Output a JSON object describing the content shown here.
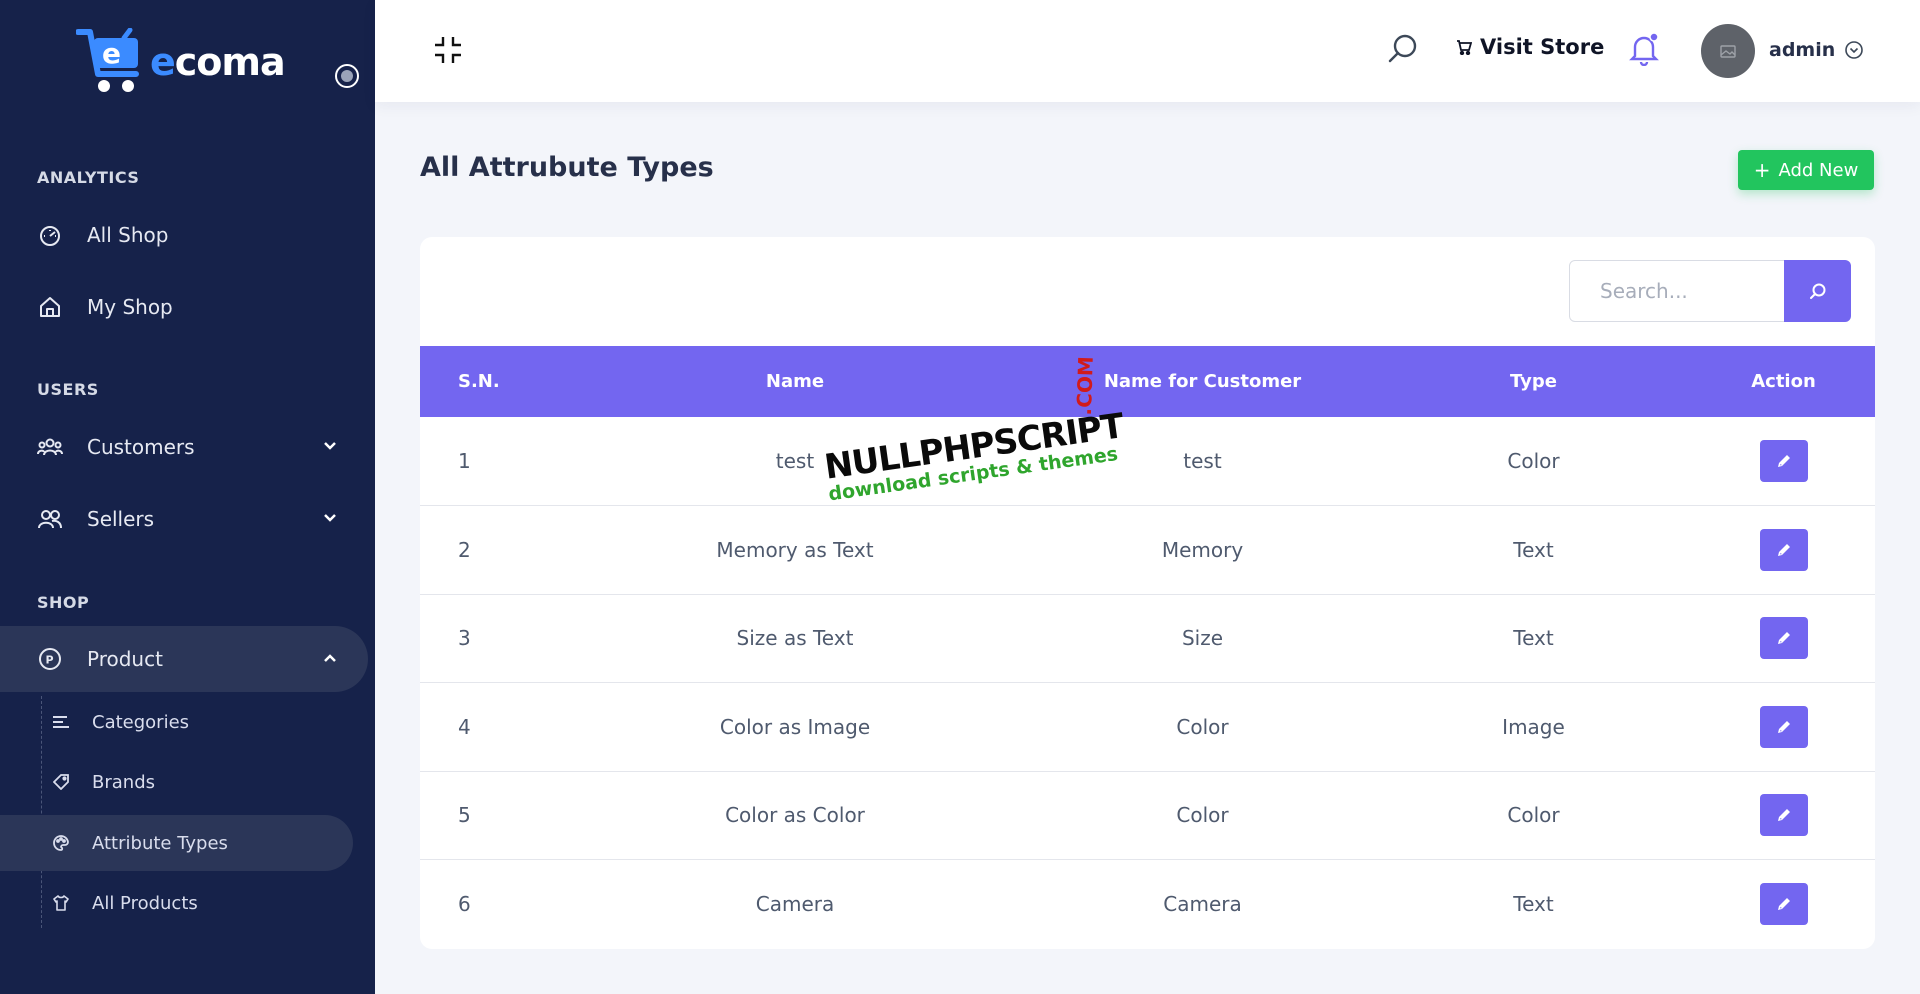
{
  "brand": {
    "name_prefix": "e",
    "name_rest": "coma"
  },
  "sidebar": {
    "sections": {
      "analytics": "ANALYTICS",
      "users": "USERS",
      "shop": "SHOP"
    },
    "items": {
      "all_shop": "All Shop",
      "my_shop": "My Shop",
      "customers": "Customers",
      "sellers": "Sellers",
      "product": "Product"
    },
    "sub_items": {
      "categories": "Categories",
      "brands": "Brands",
      "attribute_types": "Attribute Types",
      "all_products": "All Products"
    }
  },
  "header": {
    "visit_store": "Visit Store",
    "user": "admin"
  },
  "page": {
    "title": "All Attrubute Types",
    "add_new": "Add New"
  },
  "search": {
    "placeholder": "Search..."
  },
  "table": {
    "headers": {
      "sn": "S.N.",
      "name": "Name",
      "customer": "Name for Customer",
      "type": "Type",
      "action": "Action"
    },
    "rows": [
      {
        "sn": "1",
        "name": "test",
        "customer": "test",
        "type": "Color"
      },
      {
        "sn": "2",
        "name": "Memory as Text",
        "customer": "Memory",
        "type": "Text"
      },
      {
        "sn": "3",
        "name": "Size as Text",
        "customer": "Size",
        "type": "Text"
      },
      {
        "sn": "4",
        "name": "Color as Image",
        "customer": "Color",
        "type": "Image"
      },
      {
        "sn": "5",
        "name": "Color as Color",
        "customer": "Color",
        "type": "Color"
      },
      {
        "sn": "6",
        "name": "Camera",
        "customer": "Camera",
        "type": "Text"
      }
    ]
  },
  "watermark": {
    "line1": "NULLPHPSCRIPT",
    "line2": "download scripts & themes",
    "line3": ".COM"
  },
  "colors": {
    "sidebar": "#16224a",
    "accent": "#7366f0",
    "success": "#22c55e"
  }
}
